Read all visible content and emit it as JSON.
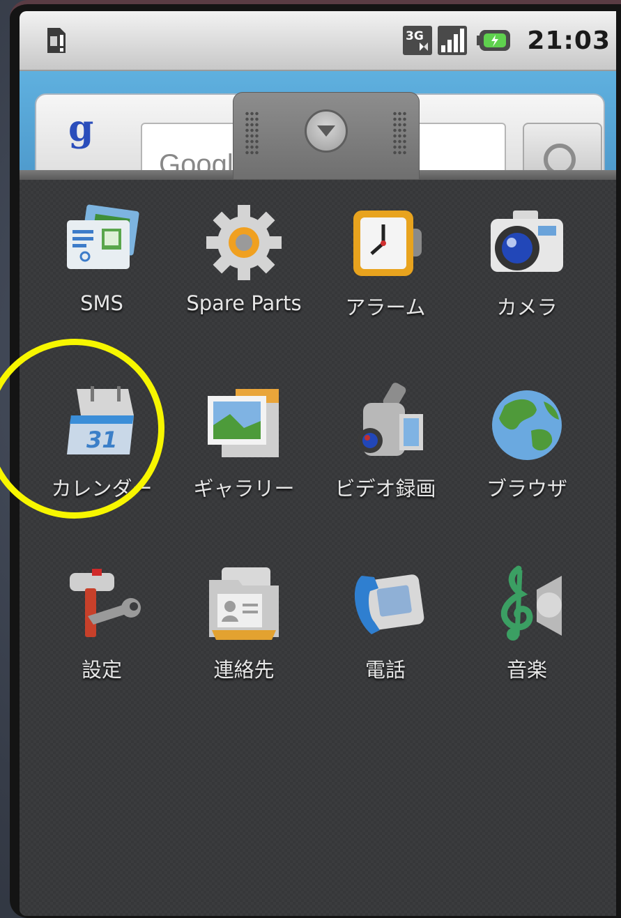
{
  "status_bar": {
    "time": "21:03",
    "icons": [
      "sim-alert-icon",
      "3g-icon",
      "signal-icon",
      "battery-charging-icon"
    ]
  },
  "home_widget": {
    "search_partial_text": "Googl",
    "icons": [
      "google-logo-icon",
      "search-icon"
    ]
  },
  "drawer_handle": {
    "icon": "chevron-down-icon"
  },
  "apps": [
    {
      "label": "SMS",
      "icon": "sms-icon"
    },
    {
      "label": "Spare Parts",
      "icon": "gear-icon"
    },
    {
      "label": "アラーム",
      "icon": "alarm-clock-icon"
    },
    {
      "label": "カメラ",
      "icon": "camera-icon"
    },
    {
      "label": "カレンダー",
      "icon": "calendar-icon"
    },
    {
      "label": "ギャラリー",
      "icon": "gallery-icon"
    },
    {
      "label": "ビデオ録画",
      "icon": "camcorder-icon"
    },
    {
      "label": "ブラウザ",
      "icon": "globe-icon"
    },
    {
      "label": "設定",
      "icon": "settings-tools-icon"
    },
    {
      "label": "連絡先",
      "icon": "contacts-folder-icon"
    },
    {
      "label": "電話",
      "icon": "phone-icon"
    },
    {
      "label": "音楽",
      "icon": "music-icon"
    }
  ],
  "calendar_icon_text": "31",
  "annotation": {
    "highlight_color": "#f7f600",
    "highlighted_app": "カレンダー"
  }
}
